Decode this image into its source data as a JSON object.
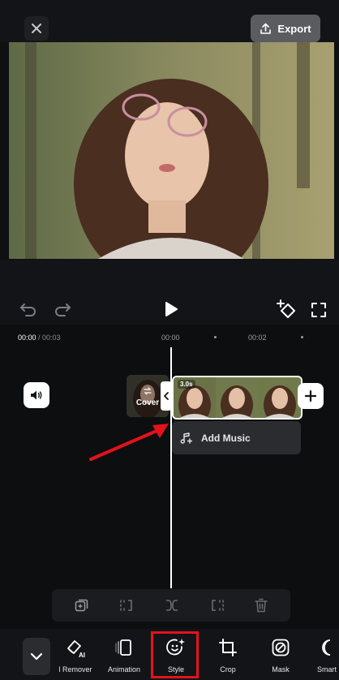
{
  "header": {
    "close_icon": "close-icon",
    "export_label": "Export",
    "export_icon": "upload-icon"
  },
  "controls": {
    "icons": [
      "undo-icon",
      "redo-icon",
      "play-icon",
      "keyframe-icon",
      "fullscreen-icon"
    ]
  },
  "timeline": {
    "current_time": "00:00",
    "total_time": "/ 00:03",
    "ruler": [
      "00:00",
      "00:02"
    ],
    "cover_label": "Cover",
    "clip_duration": "3.0s",
    "add_music_label": "Add Music"
  },
  "edit_tools": [
    "duplicate-icon",
    "split-left-icon",
    "split-icon",
    "split-right-icon",
    "delete-icon"
  ],
  "toolbar": {
    "tools": [
      {
        "label": "l Remover",
        "icon": "ai-eraser-icon"
      },
      {
        "label": "Animation",
        "icon": "animation-icon"
      },
      {
        "label": "Style",
        "icon": "style-icon",
        "highlighted": true
      },
      {
        "label": "Crop",
        "icon": "crop-icon"
      },
      {
        "label": "Mask",
        "icon": "mask-icon"
      },
      {
        "label": "Smart",
        "icon": "smart-icon"
      }
    ]
  },
  "colors": {
    "background": "#121417",
    "timeline_bg": "#0d0e10",
    "accent_highlight": "#e5121b",
    "annotation_arrow": "#e5121b"
  }
}
